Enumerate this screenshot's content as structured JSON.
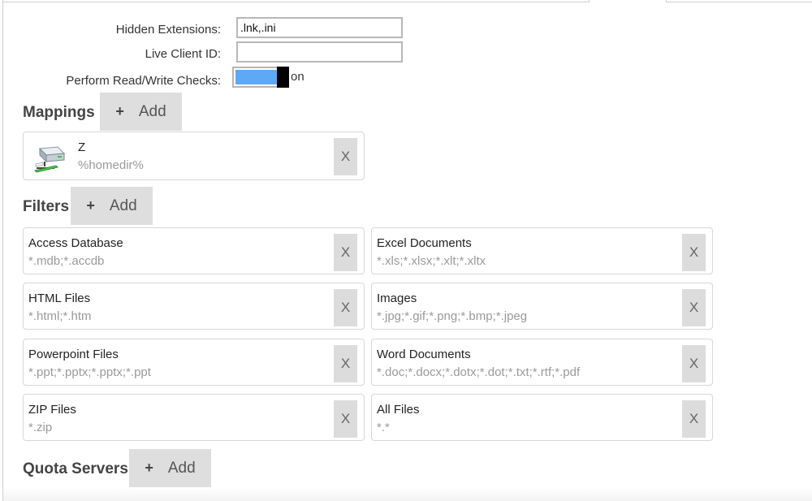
{
  "settings": {
    "hidden_extensions": {
      "label": "Hidden Extensions:",
      "value": ".lnk,.ini"
    },
    "live_client_id": {
      "label": "Live Client ID:",
      "value": ""
    },
    "read_write_checks": {
      "label": "Perform Read/Write Checks:",
      "state": "on",
      "enabled": true
    }
  },
  "mappings": {
    "title": "Mappings",
    "add_label": "Add",
    "items": [
      {
        "name": "Z",
        "path": "%homedir%",
        "delete_label": "X",
        "icon": "network-drive-icon"
      }
    ]
  },
  "filters": {
    "title": "Filters",
    "add_label": "Add",
    "items": [
      {
        "name": "Access Database",
        "pattern": "*.mdb;*.accdb",
        "delete_label": "X"
      },
      {
        "name": "Excel Documents",
        "pattern": "*.xls;*.xlsx;*.xlt;*.xltx",
        "delete_label": "X"
      },
      {
        "name": "HTML Files",
        "pattern": "*.html;*.htm",
        "delete_label": "X"
      },
      {
        "name": "Images",
        "pattern": "*.jpg;*.gif;*.png;*.bmp;*.jpeg",
        "delete_label": "X"
      },
      {
        "name": "Powerpoint Files",
        "pattern": "*.ppt;*.pptx;*.pptx;*.ppt",
        "delete_label": "X"
      },
      {
        "name": "Word Documents",
        "pattern": "*.doc;*.docx;*.dotx;*.dot;*.txt;*.rtf;*.pdf",
        "delete_label": "X"
      },
      {
        "name": "ZIP Files",
        "pattern": "*.zip",
        "delete_label": "X"
      },
      {
        "name": "All Files",
        "pattern": "*.*",
        "delete_label": "X"
      }
    ]
  },
  "quota_servers": {
    "title": "Quota Servers",
    "add_label": "Add"
  },
  "icons": {
    "add": "plus-icon",
    "delete": "close-icon",
    "mapping": "network-drive-icon"
  },
  "colors": {
    "toggle_on": "#5fa8f6",
    "button_bg": "#dedede"
  }
}
